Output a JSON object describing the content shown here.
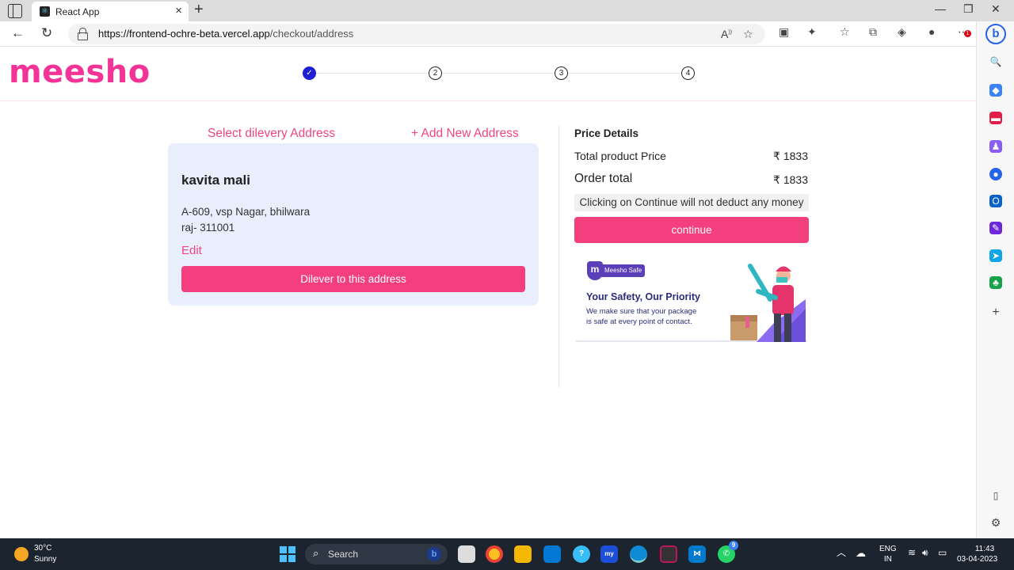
{
  "browser": {
    "tab_title": "React App",
    "tab_favicon": "react-icon",
    "url_domain": "https://frontend-ochre-beta.vercel.app",
    "url_path": "/checkout/address",
    "notification_badge": "1"
  },
  "header": {
    "logo": "meesho",
    "steps": [
      {
        "label": "✓",
        "state": "done"
      },
      {
        "label": "2",
        "state": "pending"
      },
      {
        "label": "3",
        "state": "pending"
      },
      {
        "label": "4",
        "state": "pending"
      }
    ]
  },
  "address": {
    "section_title": "Select dilevery Address",
    "add_new_label": "+ Add New Address",
    "name": "kavita mali",
    "line1": "A-609, vsp Nagar, bhilwara",
    "line2": "raj- 311001",
    "edit_label": "Edit",
    "deliver_label": "Dilever to this address"
  },
  "price": {
    "title": "Price Details",
    "product_label": "Total product Price",
    "product_value": "₹ 1833",
    "order_label": "Order total",
    "order_value": "₹ 1833",
    "note": "Clicking on Continue will not deduct any money",
    "continue_label": "continue"
  },
  "safety": {
    "badge_letter": "m",
    "badge_label": "Meesho Safe",
    "title": "Your Safety, Our Priority",
    "text1": "We make sure that your package",
    "text2": "is safe at every point of contact."
  },
  "taskbar": {
    "temperature": "30°C",
    "weather": "Sunny",
    "search_label": "Search",
    "lang1": "ENG",
    "lang2": "IN",
    "time": "11:43",
    "date": "03-04-2023",
    "whatsapp_badge": "9"
  },
  "colors": {
    "brand_pink": "#f43397",
    "button_pink": "#f43f7f",
    "card_bg": "#e8eefc",
    "step_done": "#1f1fd4"
  }
}
